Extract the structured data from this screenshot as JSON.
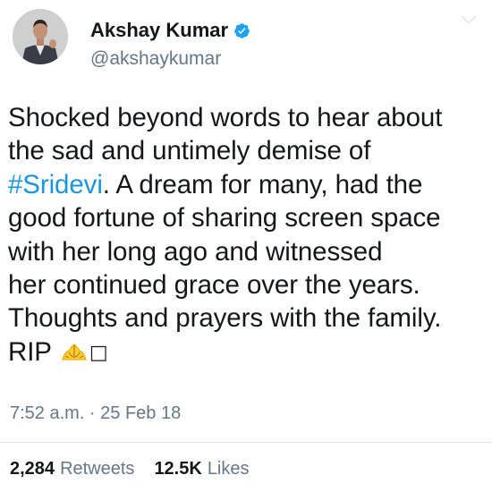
{
  "tweet": {
    "author": {
      "display_name": "Akshay Kumar",
      "handle": "@akshaykumar",
      "verified_icon": "verified-badge-icon",
      "avatar_icon": "avatar"
    },
    "text_lines": [
      "Shocked beyond words to hear about",
      "the sad and untimely demise of",
      {
        "hashtag": "#Sridevi",
        "rest": ". A dream for many, had the"
      },
      "good fortune of sharing screen space",
      "with her long ago and witnessed",
      "her continued grace over the years.",
      "Thoughts and prayers with the family.",
      {
        "text": "RIP",
        "emoji": "folded-hands-icon",
        "glyph": "□"
      }
    ],
    "timestamp": "7:52 a.m. · 25 Feb 18",
    "stats": {
      "retweets_count": "2,284",
      "retweets_label": "Retweets",
      "likes_count": "12.5K",
      "likes_label": "Likes"
    }
  },
  "colors": {
    "text": "#14171a",
    "secondary": "#657786",
    "link": "#1b95e0",
    "verified": "#1da1f2",
    "divider": "#e1e8ed"
  }
}
